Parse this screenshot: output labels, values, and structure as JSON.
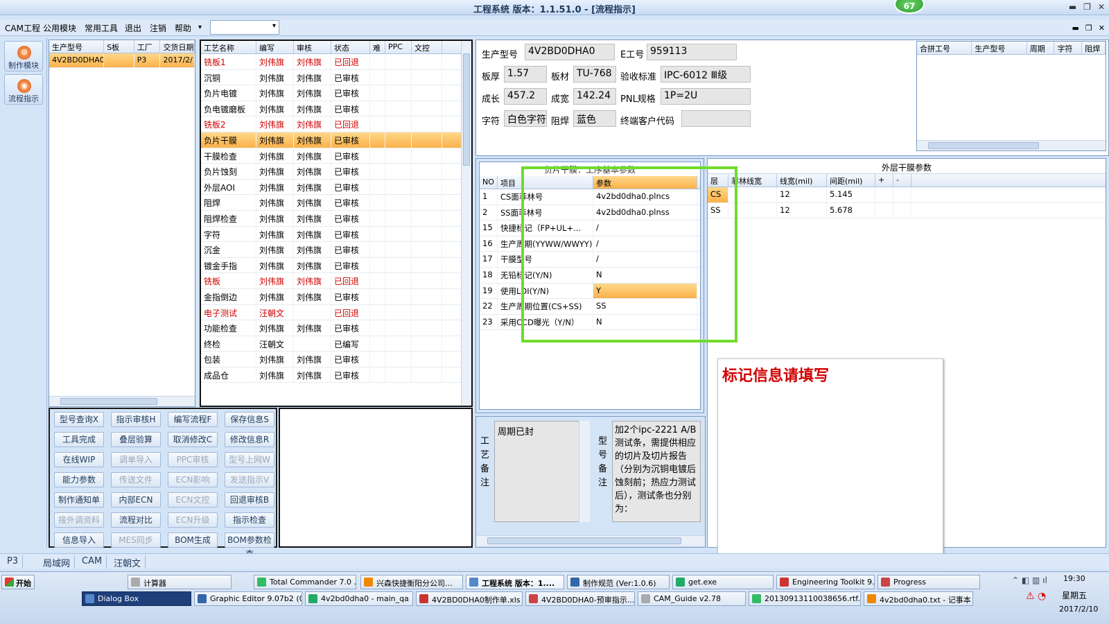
{
  "window": {
    "title": "工程系统  版本：1.1.51.0 - [流程指示]",
    "badge": "67",
    "min": "▬",
    "max": "❐",
    "close": "✕"
  },
  "menu": {
    "items": [
      "CAM工程",
      "公用模块",
      "常用工具",
      "退出",
      "注销",
      "帮助"
    ],
    "dropdown_arrow": "▾",
    "mdi_min": "▬",
    "mdi_max": "❐",
    "mdi_close": "✕"
  },
  "leftbar": {
    "buttons": [
      "制作模块",
      "流程指示"
    ]
  },
  "orders": {
    "headers": [
      "生产型号",
      "S板",
      "工厂",
      "交货日期"
    ],
    "rows": [
      [
        "4V2BD0DHA0",
        "",
        "P3",
        "2017/2/"
      ]
    ]
  },
  "process": {
    "headers": [
      "工艺名称",
      "编写",
      "审核",
      "状态",
      "难",
      "PPC",
      "文控"
    ],
    "rows": [
      [
        "铣板1",
        "刘伟旗",
        "刘伟旗",
        "已回退",
        "r"
      ],
      [
        "沉铜",
        "刘伟旗",
        "刘伟旗",
        "已审核",
        ""
      ],
      [
        "负片电镀",
        "刘伟旗",
        "刘伟旗",
        "已审核",
        ""
      ],
      [
        "负电镀磨板",
        "刘伟旗",
        "刘伟旗",
        "已审核",
        ""
      ],
      [
        "铣板2",
        "刘伟旗",
        "刘伟旗",
        "已回退",
        "r"
      ],
      [
        "负片干膜",
        "刘伟旗",
        "刘伟旗",
        "已审核",
        "s"
      ],
      [
        "干膜检查",
        "刘伟旗",
        "刘伟旗",
        "已审核",
        ""
      ],
      [
        "负片蚀刻",
        "刘伟旗",
        "刘伟旗",
        "已审核",
        ""
      ],
      [
        "外层AOI",
        "刘伟旗",
        "刘伟旗",
        "已审核",
        ""
      ],
      [
        "阻焊",
        "刘伟旗",
        "刘伟旗",
        "已审核",
        ""
      ],
      [
        "阻焊检查",
        "刘伟旗",
        "刘伟旗",
        "已审核",
        ""
      ],
      [
        "字符",
        "刘伟旗",
        "刘伟旗",
        "已审核",
        ""
      ],
      [
        "沉金",
        "刘伟旗",
        "刘伟旗",
        "已审核",
        ""
      ],
      [
        "镀金手指",
        "刘伟旗",
        "刘伟旗",
        "已审核",
        ""
      ],
      [
        "铣板",
        "刘伟旗",
        "刘伟旗",
        "已回退",
        "r"
      ],
      [
        "金指倒边",
        "刘伟旗",
        "刘伟旗",
        "已审核",
        ""
      ],
      [
        "电子测试",
        "汪朝文",
        "",
        "已回退",
        "r"
      ],
      [
        "功能检查",
        "刘伟旗",
        "刘伟旗",
        "已审核",
        ""
      ],
      [
        "终检",
        "汪朝文",
        "",
        "已编写",
        ""
      ],
      [
        "包装",
        "刘伟旗",
        "刘伟旗",
        "已审核",
        ""
      ],
      [
        "成品仓",
        "刘伟旗",
        "刘伟旗",
        "已审核",
        ""
      ]
    ]
  },
  "buttons": [
    [
      "型号查询X",
      "指示审核H",
      "编写流程F",
      "保存信息S"
    ],
    [
      "工具完成",
      "叠层验算",
      "取消修改C",
      "修改信息R"
    ],
    [
      "在线WIP",
      "调单导入",
      "PPC审核",
      "型号上网W"
    ],
    [
      "能力参数",
      "传送文件",
      "ECN影响",
      "发送指示V"
    ],
    [
      "制作通知单",
      "内部ECN",
      "ECN文控",
      "回退审核B"
    ],
    [
      "接外调资料",
      "流程对比",
      "ECN升级",
      "指示检查"
    ],
    [
      "信息导入",
      "MES同步",
      "BOM生成",
      "BOM参数检查"
    ]
  ],
  "buttons_disabled": [
    [
      0,
      0,
      0,
      0
    ],
    [
      0,
      0,
      0,
      0
    ],
    [
      0,
      1,
      1,
      1
    ],
    [
      0,
      1,
      1,
      1
    ],
    [
      0,
      0,
      1,
      0
    ],
    [
      1,
      0,
      1,
      0
    ],
    [
      0,
      1,
      0,
      0
    ]
  ],
  "info": {
    "model_label": "生产型号",
    "model": "4V2BD0DHA0",
    "eno_label": "E工号",
    "eno": "959113",
    "thick_label": "板厚",
    "thick": "1.57",
    "mat_label": "板材",
    "mat": "TU-768",
    "std_label": "验收标准",
    "std": "IPC-6012 Ⅲ级",
    "len_label": "成长",
    "len": "457.2",
    "wid_label": "成宽",
    "wid": "142.24",
    "pnl_label": "PNL规格",
    "pnl": "1P=2U",
    "char_label": "字符",
    "char": "白色字符",
    "mask_label": "阻焊",
    "mask": "蓝色",
    "cust_label": "终端客户代码",
    "cust": ""
  },
  "combine": {
    "headers": [
      "合拼工号",
      "生产型号",
      "周期",
      "字符",
      "阻焊"
    ]
  },
  "params": {
    "title": "负片干膜：工序基本参数",
    "headers": [
      "NO",
      "项目",
      "参数"
    ],
    "rows": [
      [
        "1",
        "CS面菲林号",
        "4v2bd0dha0.plncs"
      ],
      [
        "2",
        "SS面菲林号",
        "4v2bd0dha0.plnss"
      ],
      [
        "15",
        "快捷标记（FP+UL+...",
        "/"
      ],
      [
        "16",
        "生产周期(YYWW/WWYY)",
        "/"
      ],
      [
        "17",
        "干膜型号",
        "/"
      ],
      [
        "18",
        "无铅标记(Y/N)",
        "N"
      ],
      [
        "19",
        "使用LDI(Y/N)",
        "Y"
      ],
      [
        "22",
        "生产周期位置(CS+SS)",
        "SS"
      ],
      [
        "23",
        "采用CCD曝光（Y/N）",
        "N"
      ]
    ]
  },
  "outer": {
    "title": "外层干膜参数",
    "headers": [
      "层",
      "菲林线宽",
      "线宽(mil)",
      "间距(mil)",
      "+",
      "-"
    ],
    "rows": [
      [
        "CS",
        "",
        "12",
        "5.145"
      ],
      [
        "SS",
        "",
        "12",
        "5.678"
      ]
    ]
  },
  "remarks": {
    "proc_label": "工艺备注",
    "proc_text": "周期已封",
    "model_label": "型号备注",
    "model_text": "加2个ipc-2221 A/B 测试条，需提供相应的切片及切片报告（分别为沉铜电镀后蚀刻前；热应力测试后），测试条也分别为："
  },
  "note": {
    "text": "标记信息请填写"
  },
  "tabs": [
    "P3",
    "局域网",
    "CAM",
    "汪朝文"
  ],
  "taskbar": {
    "start": "开始",
    "row1": [
      "计算器",
      "Total Commander 7.0 ...",
      "兴森快捷衡阳分公司...",
      "工程系统  版本：1....",
      "制作规范 (Ver:1.0.6)",
      "get.exe",
      "Engineering Toolkit 9....",
      "Progress"
    ],
    "row2": [
      "Dialog Box",
      "Graphic Editor 9.07b2 (0...",
      "4v2bd0dha0 - main_qa",
      "4V2BD0DHA0制作单.xls ...",
      "4V2BD0DHA0-预审指示....",
      "CAM_Guide v2.78",
      "20130913110038656.rtf...",
      "4v2bd0dha0.txt - 记事本"
    ],
    "time": "19:30",
    "weekday": "星期五",
    "date": "2017/2/10"
  }
}
